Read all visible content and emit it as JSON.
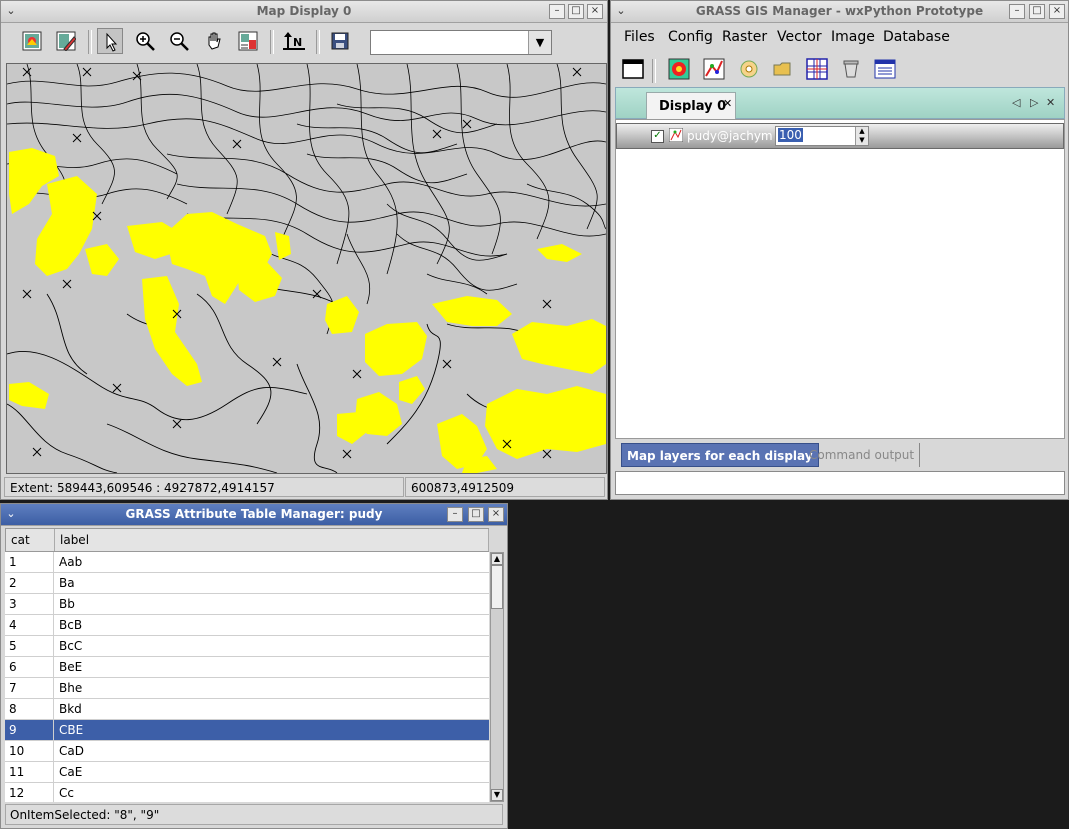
{
  "map_window": {
    "title": "Map Display 0",
    "toolbar": {
      "tools": [
        "display-map-icon",
        "erase-map-icon",
        "pointer-icon",
        "zoom-in-icon",
        "zoom-out-icon",
        "pan-icon",
        "query-icon",
        "north-arrow-icon",
        "save-icon"
      ],
      "combo_value": ""
    },
    "status": {
      "extent": "Extent: 589443,609546 : 4927872,4914157",
      "coords": "600873,4912509"
    },
    "colors": {
      "map_background": "#c8c8c8",
      "highlight_areas": "#ffff00",
      "boundaries": "#000000"
    }
  },
  "manager_window": {
    "title": "GRASS GIS Manager - wxPython Prototype",
    "menu": [
      "Files",
      "Config",
      "Raster",
      "Vector",
      "Image",
      "Database"
    ],
    "toolbar_icons": [
      "new-display-icon",
      "add-raster-icon",
      "add-vector-icon",
      "add-command-icon",
      "open-folder-icon",
      "add-grid-icon",
      "delete-layer-icon",
      "attribute-table-icon"
    ],
    "display_tab": "Display 0",
    "layer": {
      "name": "pudy@jachym",
      "checked": true,
      "opacity": "100"
    },
    "bottom_tabs": [
      "Map layers for each display",
      "Command output"
    ],
    "colors": {
      "tabbar": "#a8d8cc",
      "active_tab": "#5a73b3"
    }
  },
  "table_window": {
    "title": "GRASS Attribute Table Manager: pudy",
    "columns": [
      "cat",
      "label"
    ],
    "rows": [
      {
        "cat": "1",
        "label": "Aab"
      },
      {
        "cat": "2",
        "label": "Ba"
      },
      {
        "cat": "3",
        "label": "Bb"
      },
      {
        "cat": "4",
        "label": "BcB"
      },
      {
        "cat": "5",
        "label": "BcC"
      },
      {
        "cat": "6",
        "label": "BeE"
      },
      {
        "cat": "7",
        "label": "Bhe"
      },
      {
        "cat": "8",
        "label": "Bkd"
      },
      {
        "cat": "9",
        "label": "CBE"
      },
      {
        "cat": "10",
        "label": "CaD"
      },
      {
        "cat": "11",
        "label": "CaE"
      },
      {
        "cat": "12",
        "label": "Cc"
      }
    ],
    "selected_cat": "9",
    "status": "OnItemSelected: \"8\", \"9\"",
    "colors": {
      "selected_row": "#3d5fa8"
    }
  }
}
